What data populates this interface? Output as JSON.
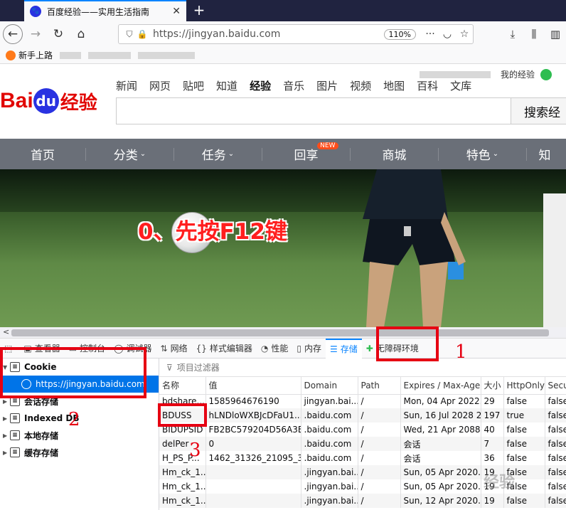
{
  "browser": {
    "tab_title": "百度经验——实用生活指南",
    "tab_favicon": "paw-icon",
    "url": "https://jingyan.baidu.com",
    "zoom": "110%",
    "bookmark_label": "新手上路"
  },
  "site": {
    "top_link": "我的经验",
    "logo_bai": "Bai",
    "logo_du": "du",
    "logo_jingyan": "经验",
    "categories": [
      "新闻",
      "网页",
      "贴吧",
      "知道",
      "经验",
      "音乐",
      "图片",
      "视频",
      "地图",
      "百科",
      "文库"
    ],
    "search_button": "搜索经",
    "menu": [
      "首页",
      "分类",
      "任务",
      "回享",
      "商城",
      "特色",
      "知"
    ],
    "new_badge": "NEW",
    "banner_caption": "0、先按F12键"
  },
  "devtools": {
    "tabs": [
      "查看器",
      "控制台",
      "调试器",
      "网络",
      "样式编辑器",
      "性能",
      "内存",
      "存储",
      "无障碍环境"
    ],
    "sidebar": [
      "Cookie",
      "https://jingyan.baidu.com",
      "会话存储",
      "Indexed DB",
      "本地存储",
      "缓存存储"
    ],
    "filter_placeholder": "项目过滤器",
    "columns": [
      "名称",
      "值",
      "Domain",
      "Path",
      "Expires / Max-Age",
      "大小",
      "HttpOnly",
      "Secu"
    ],
    "rows": [
      [
        "bdshare...",
        "1585964676190",
        "jingyan.bai...",
        "/",
        "Mon, 04 Apr 2022...",
        "29",
        "false",
        "false"
      ],
      [
        "BDUSS",
        "hLNDloWXBJcDFaU1...",
        ".baidu.com",
        "/",
        "Sun, 16 Jul 2028 2...",
        "197",
        "true",
        "false"
      ],
      [
        "BIDUPSID",
        "FB2BC579204D56A3B...",
        ".baidu.com",
        "/",
        "Wed, 21 Apr 2088...",
        "40",
        "false",
        "false"
      ],
      [
        "delPer",
        "0",
        ".baidu.com",
        "/",
        "会话",
        "7",
        "false",
        "false"
      ],
      [
        "H_PS_P...",
        "1462_31326_21095_3...",
        ".baidu.com",
        "/",
        "会话",
        "36",
        "false",
        "false"
      ],
      [
        "Hm_ck_1...",
        "",
        ".jingyan.bai...",
        "/",
        "Sun, 05 Apr 2020...",
        "19",
        "false",
        "false"
      ],
      [
        "Hm_ck_1...",
        "",
        ".jingyan.bai...",
        "/",
        "Sun, 05 Apr 2020...",
        "19",
        "false",
        "false"
      ],
      [
        "Hm_ck_1...",
        "",
        ".jingyan.bai...",
        "/",
        "Sun, 12 Apr 2020...",
        "19",
        "false",
        "false"
      ]
    ]
  },
  "annotations": {
    "n1": "1",
    "n2": "2",
    "n3": "3",
    "watermark": "经验"
  },
  "colors": {
    "accent": "#0a84ff",
    "baidu_red": "#e10602",
    "baidu_blue": "#2932e1",
    "annotation_red": "#e60012"
  }
}
